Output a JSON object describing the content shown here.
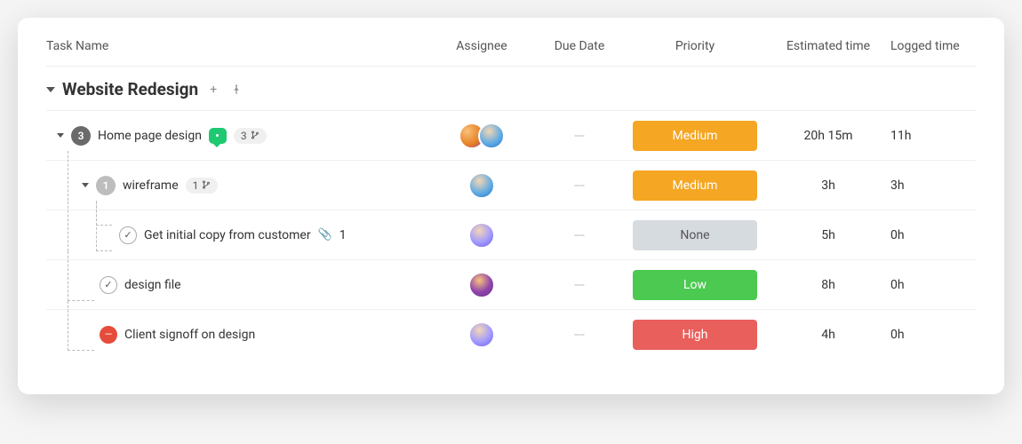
{
  "columns": {
    "name": "Task Name",
    "assignee": "Assignee",
    "due": "Due Date",
    "priority": "Priority",
    "est": "Estimated time",
    "log": "Logged time"
  },
  "group": {
    "title": "Website Redesign"
  },
  "rows": [
    {
      "count": "3",
      "name": "Home page design",
      "subtasks_pill": "3",
      "due": "---",
      "priority": "Medium",
      "est": "20h 15m",
      "log": "11h"
    },
    {
      "count": "1",
      "name": "wireframe",
      "subtasks_pill": "1",
      "due": "---",
      "priority": "Medium",
      "est": "3h",
      "log": "3h"
    },
    {
      "name": "Get initial copy from customer",
      "attach": "1",
      "due": "---",
      "priority": "None",
      "est": "5h",
      "log": "0h"
    },
    {
      "name": "design file",
      "due": "---",
      "priority": "Low",
      "est": "8h",
      "log": "0h"
    },
    {
      "name": "Client signoff on design",
      "due": "---",
      "priority": "High",
      "est": "4h",
      "log": "0h"
    }
  ]
}
